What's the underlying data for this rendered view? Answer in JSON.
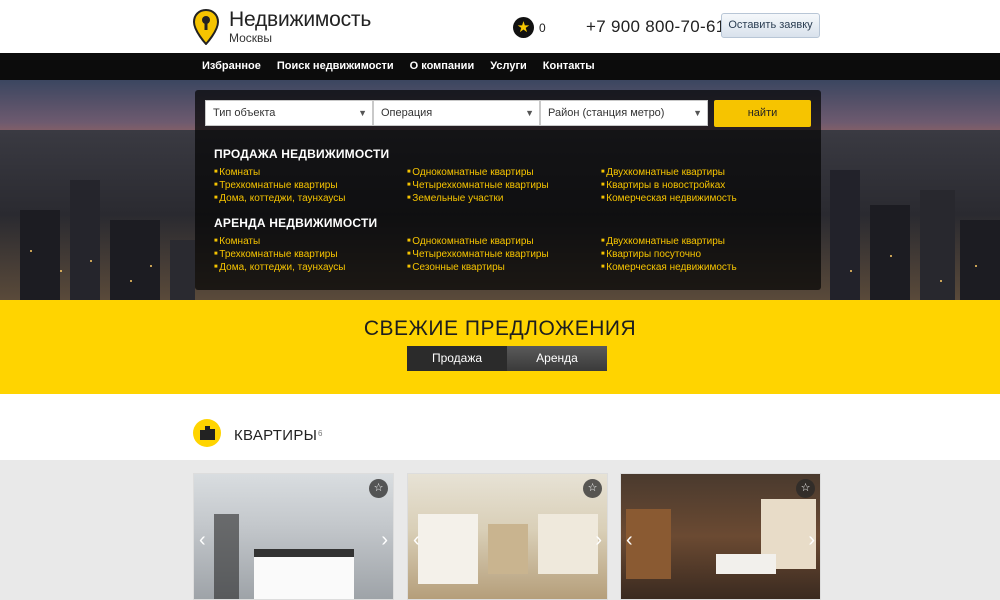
{
  "header": {
    "logo_title": "Недвижимость",
    "logo_subtitle": "Москвы",
    "favorites_count": "0",
    "phone": "+7 900 800-70-61",
    "request_button": "Оставить заявку"
  },
  "nav": {
    "items": [
      "Избранное",
      "Поиск недвижимости",
      "О компании",
      "Услуги",
      "Контакты"
    ]
  },
  "search": {
    "type_select": "Тип объекта",
    "operation_select": "Операция",
    "district_select": "Район (станция метро)",
    "find_button": "найти"
  },
  "sale": {
    "title": "ПРОДАЖА НЕДВИЖИМОСТИ",
    "col1": [
      "Комнаты",
      "Трехкомнатные квартиры",
      "Дома, коттеджи, таунхаусы"
    ],
    "col2": [
      "Однокомнатные квартиры",
      "Четырехкомнатные квартиры",
      "Земельные участки"
    ],
    "col3": [
      "Двухкомнатные квартиры",
      "Квартиры в новостройках",
      "Комерческая недвижимость"
    ]
  },
  "rent": {
    "title": "АРЕНДА НЕДВИЖИМОСТИ",
    "col1": [
      "Комнаты",
      "Трехкомнатные квартиры",
      "Дома, коттеджи, таунхаусы"
    ],
    "col2": [
      "Однокомнатные квартиры",
      "Четырехкомнатные квартиры",
      "Сезонные квартиры"
    ],
    "col3": [
      "Двухкомнатные квартиры",
      "Квартиры посуточно",
      "Комерческая недвижимость"
    ]
  },
  "offers": {
    "title": "СВЕЖИЕ ПРЕДЛОЖЕНИЯ",
    "tab_sale": "Продажа",
    "tab_rent": "Аренда"
  },
  "apartments": {
    "title": "КВАРТИРЫ",
    "count": "6"
  },
  "colors": {
    "accent_yellow": "#ffd400",
    "nav_black": "#0c0c0c"
  }
}
